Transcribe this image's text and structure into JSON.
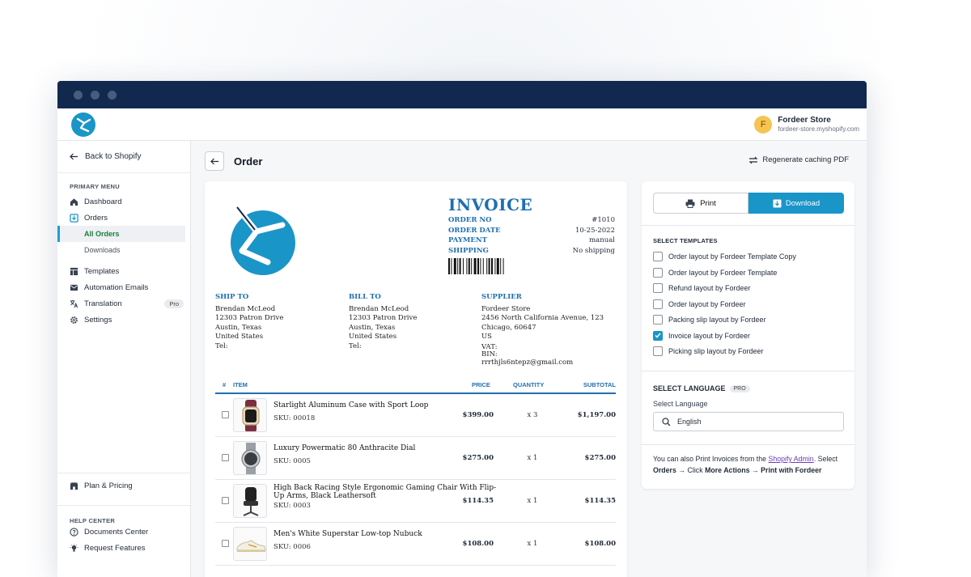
{
  "app": {
    "store_name": "Fordeer Store",
    "store_domain": "fordeer-store.myshopify.com",
    "avatar_initial": "F"
  },
  "sidebar": {
    "back_label": "Back to Shopify",
    "primary_menu_heading": "PRIMARY MENU",
    "items": [
      {
        "label": "Dashboard",
        "icon": "home-icon"
      },
      {
        "label": "Orders",
        "icon": "orders-icon"
      },
      {
        "label": "All Orders",
        "icon": ""
      },
      {
        "label": "Downloads",
        "icon": ""
      },
      {
        "label": "Templates",
        "icon": "templates-icon"
      },
      {
        "label": "Automation Emails",
        "icon": "mail-icon"
      },
      {
        "label": "Translation",
        "icon": "translate-icon",
        "badge": "Pro"
      },
      {
        "label": "Settings",
        "icon": "gear-icon"
      }
    ],
    "plan_label": "Plan & Pricing",
    "help_heading": "HELP CENTER",
    "help_items": [
      {
        "label": "Documents Center",
        "icon": "help-circle-icon"
      },
      {
        "label": "Request Features",
        "icon": "bulb-icon"
      }
    ]
  },
  "page": {
    "title": "Order",
    "regenerate_label": "Regenerate caching PDF"
  },
  "invoice": {
    "title": "INVOICE",
    "meta": [
      {
        "key": "ORDER NO",
        "value": "#1010"
      },
      {
        "key": "ORDER DATE",
        "value": "10-25-2022"
      },
      {
        "key": "PAYMENT",
        "value": "manual"
      },
      {
        "key": "SHIPPING",
        "value": "No shipping"
      }
    ],
    "ship_to": {
      "heading": "SHIP TO",
      "lines": [
        "Brendan McLeod",
        "12303 Patron Drive",
        "Austin, Texas",
        "United States",
        "Tel:"
      ]
    },
    "bill_to": {
      "heading": "BILL TO",
      "lines": [
        "Brendan McLeod",
        "12303 Patron Drive",
        "Austin, Texas",
        "United States",
        "Tel:"
      ]
    },
    "supplier": {
      "heading": "SUPPLIER",
      "lines": [
        "Fordeer Store",
        "2456 North California Avenue, 123",
        "Chicago, 60647",
        "US",
        "VAT:",
        "BIN:",
        "rrrthjls6ntepz@gmail.com"
      ]
    },
    "columns": {
      "num": "#",
      "item": "ITEM",
      "price": "PRICE",
      "quantity": "QUANTITY",
      "subtotal": "SUBTOTAL"
    },
    "items": [
      {
        "name": "Starlight Aluminum Case with Sport Loop",
        "sku": "SKU: 00018",
        "price": "$399.00",
        "qty": "x 3",
        "subtotal": "$1,197.00",
        "thumb": "watch-icon"
      },
      {
        "name": "Luxury Powermatic 80 Anthracite Dial",
        "sku": "SKU: 0005",
        "price": "$275.00",
        "qty": "x 1",
        "subtotal": "$275.00",
        "thumb": "watch-icon"
      },
      {
        "name": "High Back Racing Style Ergonomic Gaming Chair With Flip-Up Arms, Black Leathersoft",
        "sku": "SKU: 0003",
        "price": "$114.35",
        "qty": "x 1",
        "subtotal": "$114.35",
        "thumb": "chair-icon"
      },
      {
        "name": "Men's White Superstar Low-top Nubuck",
        "sku": "SKU: 0006",
        "price": "$108.00",
        "qty": "x 1",
        "subtotal": "$108.00",
        "thumb": "shoe-icon"
      }
    ]
  },
  "actions": {
    "print_label": "Print",
    "download_label": "Download"
  },
  "templates": {
    "heading": "SELECT TEMPLATES",
    "options": [
      {
        "label": "Order layout by Fordeer Template Copy",
        "checked": false
      },
      {
        "label": "Order layout by Fordeer Template",
        "checked": false
      },
      {
        "label": "Refund layout by Fordeer",
        "checked": false
      },
      {
        "label": "Order layout by Fordeer",
        "checked": false
      },
      {
        "label": "Packing slip layout by Fordeer",
        "checked": false
      },
      {
        "label": "Invoice layout by Fordeer",
        "checked": true
      },
      {
        "label": "Picking slip layout by Fordeer",
        "checked": false
      }
    ]
  },
  "language": {
    "heading": "SELECT LANGUAGE",
    "badge": "PRO",
    "label": "Select Language",
    "value": "English"
  },
  "note": {
    "prefix": "You can also Print Invoices from the ",
    "link": "Shopify Admin",
    "middle": ". Select ",
    "orders": "Orders",
    "arrow1": " → Click ",
    "more_actions": "More Actions",
    "arrow2": " → ",
    "print_with": "Print with Fordeer"
  },
  "colors": {
    "titlebar": "#12294f",
    "accent": "#1a95c8",
    "invoice_blue": "#1f6fb0"
  }
}
